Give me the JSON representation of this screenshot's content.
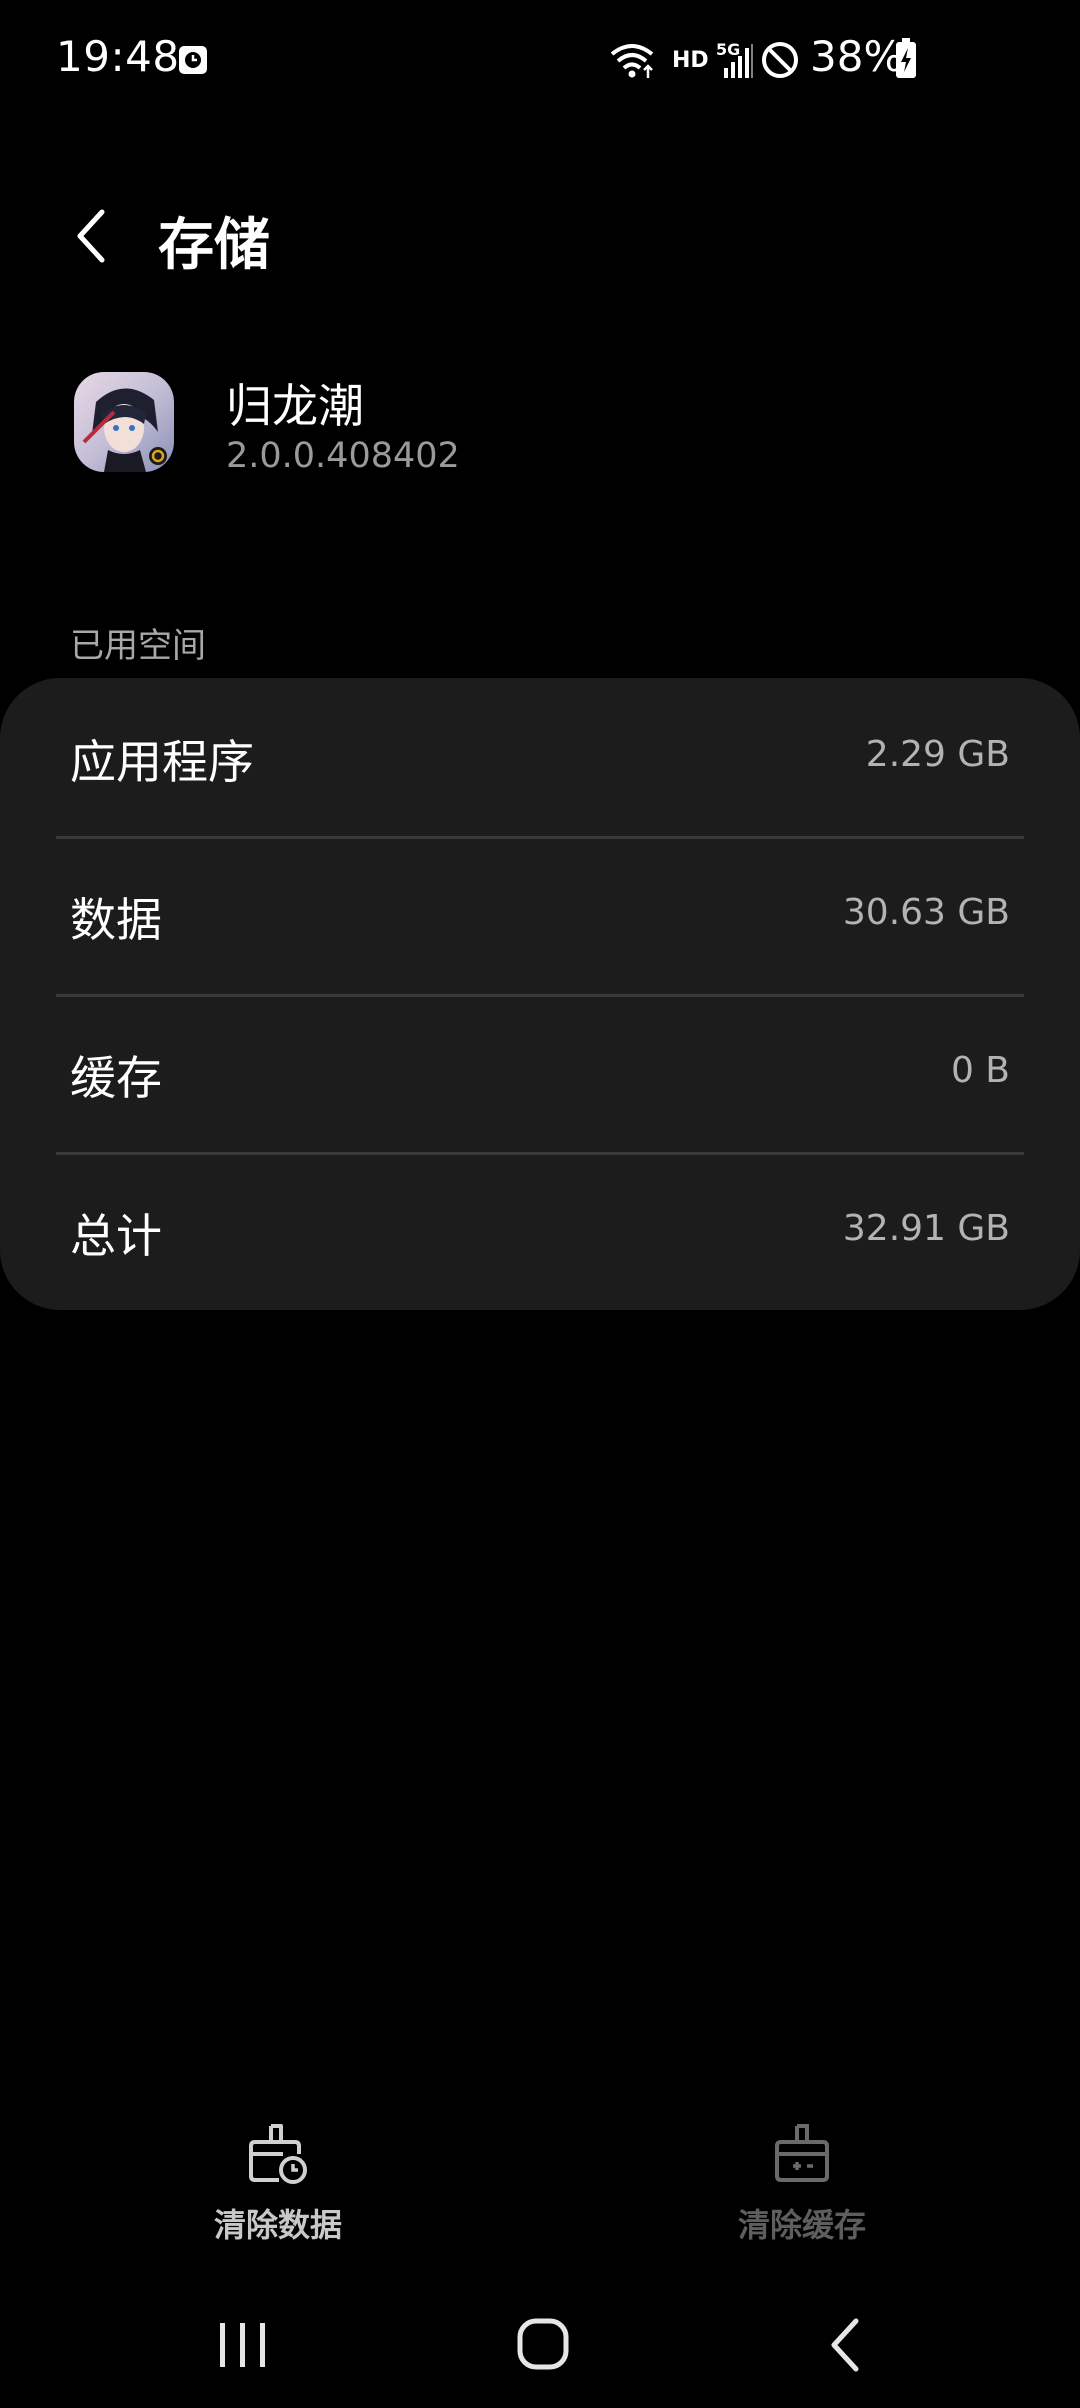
{
  "status_bar": {
    "time": "19:48",
    "battery_percent": "38%",
    "network_label": "HD",
    "signal_label": "5G"
  },
  "header": {
    "title": "存储"
  },
  "app": {
    "name": "归龙潮",
    "version": "2.0.0.408402"
  },
  "section": {
    "label": "已用空间"
  },
  "storage_rows": [
    {
      "label": "应用程序",
      "value": "2.29 GB"
    },
    {
      "label": "数据",
      "value": "30.63 GB"
    },
    {
      "label": "缓存",
      "value": "0 B"
    },
    {
      "label": "总计",
      "value": "32.91 GB"
    }
  ],
  "actions": {
    "clear_data": "清除数据",
    "clear_cache": "清除缓存"
  },
  "colors": {
    "background": "#000000",
    "card": "#1c1c1c",
    "secondary_text": "#9a9a9a",
    "disabled_text": "#5e5e5e"
  }
}
